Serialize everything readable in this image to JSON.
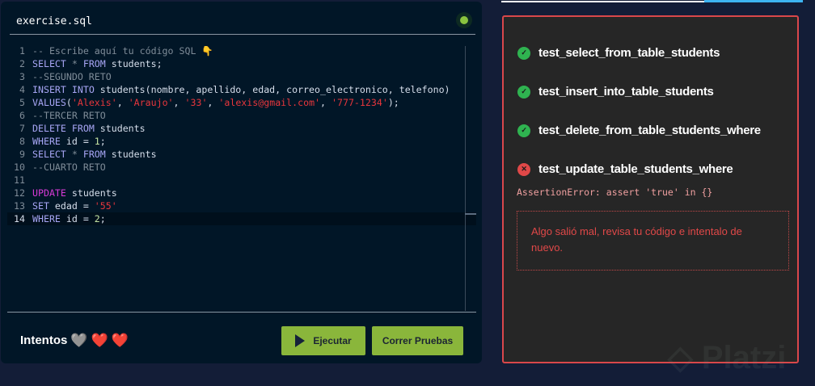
{
  "editor": {
    "filename": "exercise.sql",
    "lines": [
      [
        {
          "t": "-- Escribe aquí tu código SQL 👇",
          "c": "cm"
        }
      ],
      [
        {
          "t": "SELECT",
          "c": "kw"
        },
        {
          "t": " * ",
          "c": "cm"
        },
        {
          "t": "FROM",
          "c": "kw"
        },
        {
          "t": " students;",
          "c": "tx"
        }
      ],
      [
        {
          "t": "--SEGUNDO RETO",
          "c": "cm"
        }
      ],
      [
        {
          "t": "INSERT",
          "c": "kw"
        },
        {
          "t": " ",
          "c": "tx"
        },
        {
          "t": "INTO",
          "c": "kw"
        },
        {
          "t": " students(nombre, apellido, edad, correo_electronico, telefono)",
          "c": "tx"
        }
      ],
      [
        {
          "t": "VALUES",
          "c": "kw"
        },
        {
          "t": "(",
          "c": "tx"
        },
        {
          "t": "'Alexis'",
          "c": "st"
        },
        {
          "t": ", ",
          "c": "tx"
        },
        {
          "t": "'Araujo'",
          "c": "st"
        },
        {
          "t": ", ",
          "c": "tx"
        },
        {
          "t": "'33'",
          "c": "st"
        },
        {
          "t": ", ",
          "c": "tx"
        },
        {
          "t": "'alexis@gmail.com'",
          "c": "st"
        },
        {
          "t": ", ",
          "c": "tx"
        },
        {
          "t": "'777-1234'",
          "c": "st"
        },
        {
          "t": ");",
          "c": "tx"
        }
      ],
      [
        {
          "t": "--TERCER RETO",
          "c": "cm"
        }
      ],
      [
        {
          "t": "DELETE",
          "c": "kw"
        },
        {
          "t": " ",
          "c": "tx"
        },
        {
          "t": "FROM",
          "c": "kw"
        },
        {
          "t": " students",
          "c": "tx"
        }
      ],
      [
        {
          "t": "WHERE",
          "c": "kw"
        },
        {
          "t": " id = ",
          "c": "tx"
        },
        {
          "t": "1",
          "c": "nm"
        },
        {
          "t": ";",
          "c": "tx"
        }
      ],
      [
        {
          "t": "SELECT",
          "c": "kw"
        },
        {
          "t": " * ",
          "c": "cm"
        },
        {
          "t": "FROM",
          "c": "kw"
        },
        {
          "t": " students",
          "c": "tx"
        }
      ],
      [
        {
          "t": "--CUARTO RETO",
          "c": "cm"
        }
      ],
      [],
      [
        {
          "t": "UPDATE",
          "c": "up"
        },
        {
          "t": " students",
          "c": "tx"
        }
      ],
      [
        {
          "t": "SET",
          "c": "kw"
        },
        {
          "t": " edad = ",
          "c": "tx"
        },
        {
          "t": "'55'",
          "c": "st"
        }
      ],
      [
        {
          "t": "WHERE",
          "c": "kw"
        },
        {
          "t": " id = ",
          "c": "tx"
        },
        {
          "t": "2",
          "c": "nm"
        },
        {
          "t": ";",
          "c": "tx"
        }
      ]
    ],
    "active_line": 14
  },
  "colors": {
    "kw": "#a8a6f5",
    "cm": "#7f8c98",
    "tx": "#d6deeb",
    "st": "#e8363c",
    "nm": "#c5e4a3",
    "up": "#d63ad6"
  },
  "footer": {
    "attempts_label": "Intentos",
    "hearts": [
      "🩶",
      "❤️",
      "❤️"
    ],
    "run_label": "Ejecutar",
    "tests_label": "Correr Pruebas"
  },
  "results": {
    "tests": [
      {
        "name": "test_select_from_table_students",
        "passed": true
      },
      {
        "name": "test_insert_into_table_students",
        "passed": true
      },
      {
        "name": "test_delete_from_table_students_where",
        "passed": true
      },
      {
        "name": "test_update_table_students_where",
        "passed": false
      }
    ],
    "assertion": "AssertionError: assert 'true' in {}",
    "message": "Algo salió mal, revisa tu código e intentalo de nuevo."
  },
  "watermark": "Platzi"
}
